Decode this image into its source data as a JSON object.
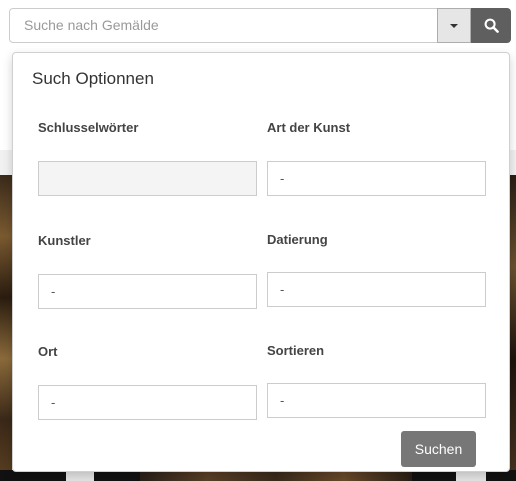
{
  "search": {
    "placeholder": "Suche nach Gemälde",
    "toggle_icon": "chevron-down-icon",
    "submit_icon": "search-icon"
  },
  "panel": {
    "title": "Such Optionnen",
    "fields": {
      "keywords": {
        "label": "Schlusselwörter",
        "value": ""
      },
      "art_type": {
        "label": "Art der Kunst",
        "value": "-"
      },
      "artist": {
        "label": "Kunstler",
        "value": "-"
      },
      "dating": {
        "label": "Datierung",
        "value": "-"
      },
      "place": {
        "label": "Ort",
        "value": "-"
      },
      "sort": {
        "label": "Sortieren",
        "value": "-"
      }
    },
    "submit_label": "Suchen"
  },
  "colors": {
    "search_button": "#5f5f5f",
    "submit_button": "#777777",
    "toggle_background": "#e6e6e6"
  }
}
